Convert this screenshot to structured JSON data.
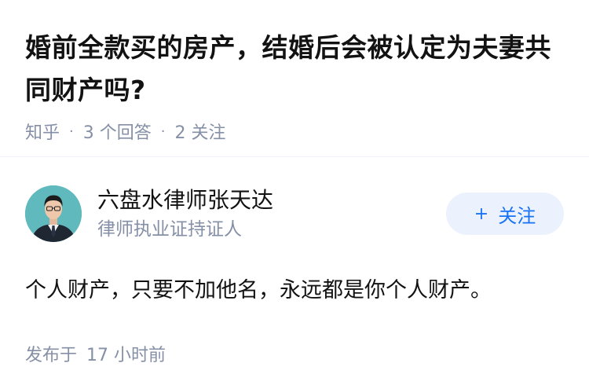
{
  "question": {
    "title": "婚前全款买的房产，结婚后会被认定为夫妻共同财产吗?",
    "source": "知乎",
    "answer_count": "3 个回答",
    "follow_count": "2 关注",
    "separator": "·"
  },
  "answer": {
    "author": {
      "name": "六盘水律师张天达",
      "headline": "律师执业证持证人",
      "avatar_icon": "avatar-man-in-suit"
    },
    "follow_button": {
      "icon": "plus-icon",
      "icon_glyph": "+",
      "label": "关注"
    },
    "content": "个人财产，只要不加他名，永远都是你个人财产。",
    "published_prefix": "发布于",
    "published_time": "17 小时前"
  },
  "colors": {
    "text_primary": "#121212",
    "text_secondary": "#8590a6",
    "accent": "#1772f6",
    "follow_bg": "#ebf2fd",
    "avatar_bg": "#5fb9bd"
  }
}
